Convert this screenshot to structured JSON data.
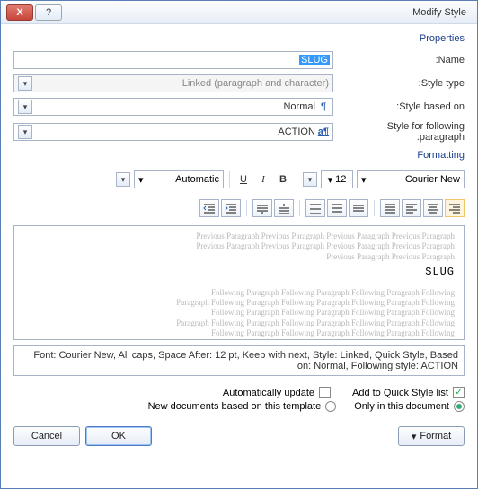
{
  "window": {
    "title": "Modify Style",
    "help": "?",
    "close": "X"
  },
  "sections": {
    "properties": "Properties",
    "formatting": "Formatting"
  },
  "labels": {
    "name": "Name:",
    "style_type": "Style type:",
    "based_on": "Style based on:",
    "following": "Style for following paragraph:"
  },
  "fields": {
    "name_value": "SLUG",
    "style_type_value": "Linked (paragraph and character)",
    "based_on_value": "Normal",
    "following_value": "ACTION"
  },
  "format": {
    "font_name": "Courier New",
    "font_size": "12",
    "bold": "B",
    "italic": "I",
    "underline": "U",
    "color_label": "Automatic"
  },
  "preview": {
    "prev_line": "Previous Paragraph Previous Paragraph Previous Paragraph Previous Paragraph",
    "sample": "SLUG",
    "foll_line": "Following Paragraph Following Paragraph Following Paragraph Following"
  },
  "description": "Font: Courier New, All caps, Space After: 12 pt, Keep with next, Style: Linked, Quick Style, Based on: Normal, Following style: ACTION",
  "options": {
    "add_quick": "Add to Quick Style list",
    "auto_update": "Automatically update",
    "only_doc": "Only in this document",
    "new_docs": "New documents based on this template"
  },
  "buttons": {
    "format": "Format",
    "ok": "OK",
    "cancel": "Cancel"
  }
}
